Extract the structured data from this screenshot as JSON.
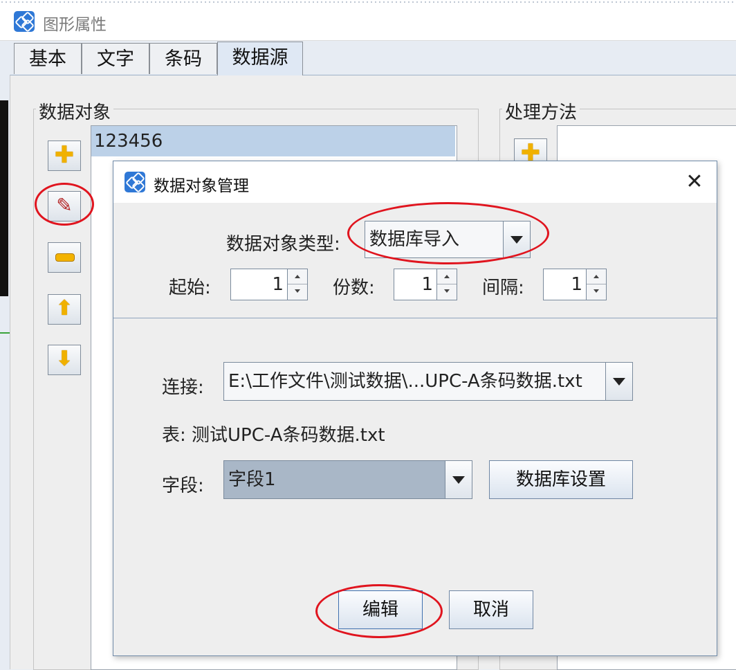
{
  "outer_window": {
    "title": "图形属性"
  },
  "tabs": [
    {
      "label": "基本"
    },
    {
      "label": "文字"
    },
    {
      "label": "条码"
    },
    {
      "label": "数据源",
      "active": true
    }
  ],
  "data_objects": {
    "title": "数据对象",
    "items": [
      "123456"
    ],
    "tools": [
      "add-icon",
      "edit-icon",
      "remove-icon",
      "move-up-icon",
      "move-down-icon"
    ]
  },
  "process_methods": {
    "title": "处理方法",
    "tools": [
      "add-icon"
    ]
  },
  "dialog": {
    "title": "数据对象管理",
    "type_label": "数据对象类型:",
    "type_value": "数据库导入",
    "start_label": "起始:",
    "start_value": "1",
    "copies_label": "份数:",
    "copies_value": "1",
    "interval_label": "间隔:",
    "interval_value": "1",
    "connection_label": "连接:",
    "connection_value": "E:\\工作文件\\测试数据\\...UPC-A条码数据.txt",
    "table_text": "表: 测试UPC-A条码数据.txt",
    "field_label": "字段:",
    "field_value": "字段1",
    "db_settings_label": "数据库设置",
    "edit_label": "编辑",
    "cancel_label": "取消"
  },
  "colors": {
    "accent": "#2f78d6",
    "selection": "#bcd1e8",
    "annotation": "#e0141e"
  }
}
